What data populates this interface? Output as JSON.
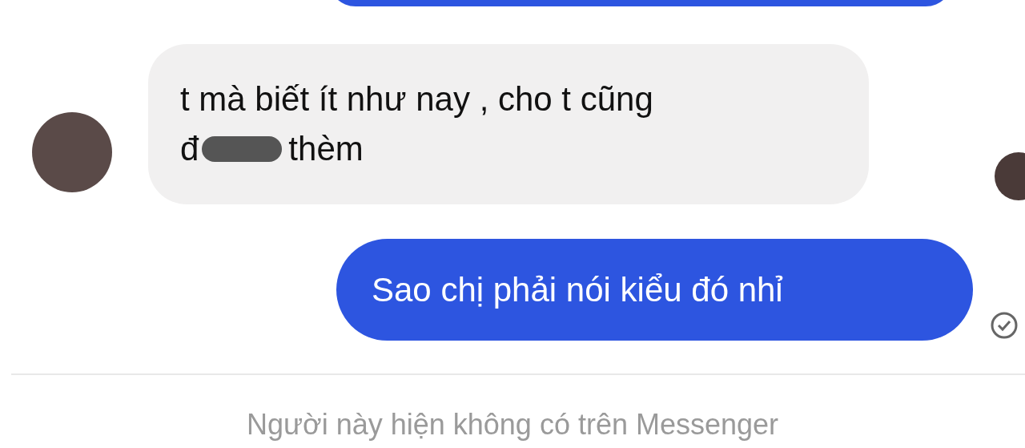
{
  "messages": [
    {
      "kind": "incoming",
      "lines": [
        "t mà biết ít như nay , cho t cũng",
        "đ thèm"
      ],
      "redacted": true
    },
    {
      "kind": "outgoing",
      "lines": [
        "Sao chị phải nói kiểu đó nhỉ"
      ],
      "read": true
    }
  ],
  "notice": "Người này hiện không có trên Messenger"
}
